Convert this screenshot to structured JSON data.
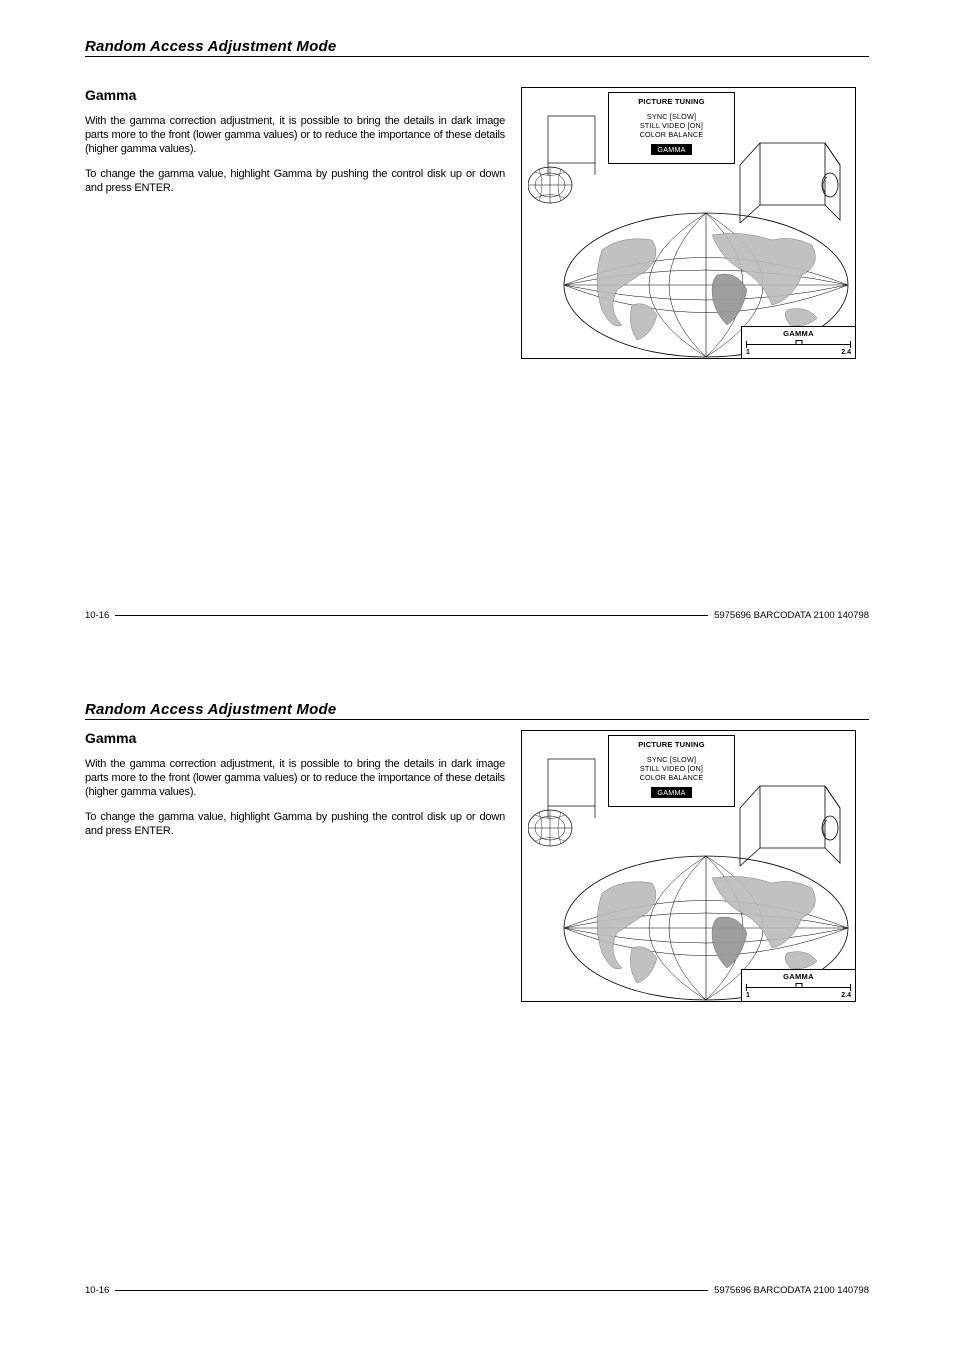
{
  "header": {
    "title": "Random Access Adjustment Mode"
  },
  "section": {
    "title": "Gamma",
    "para1": "With the gamma correction adjustment, it is possible to bring the details in dark image parts more to the front (lower gamma values) or to reduce the importance of these details (higher gamma values).",
    "para2": "To change the gamma value, highlight Gamma by pushing the control disk up or down and press ENTER."
  },
  "menu": {
    "title": "PICTURE TUNING",
    "items": [
      "SYNC [SLOW]",
      "STILL VIDEO [ON]",
      "COLOR BALANCE"
    ],
    "selected": "GAMMA"
  },
  "gammaBox": {
    "title": "GAMMA",
    "min": "1",
    "max": "2.4"
  },
  "footer": {
    "left": "10-16",
    "right": "5975696 BARCODATA 2100 140798"
  }
}
